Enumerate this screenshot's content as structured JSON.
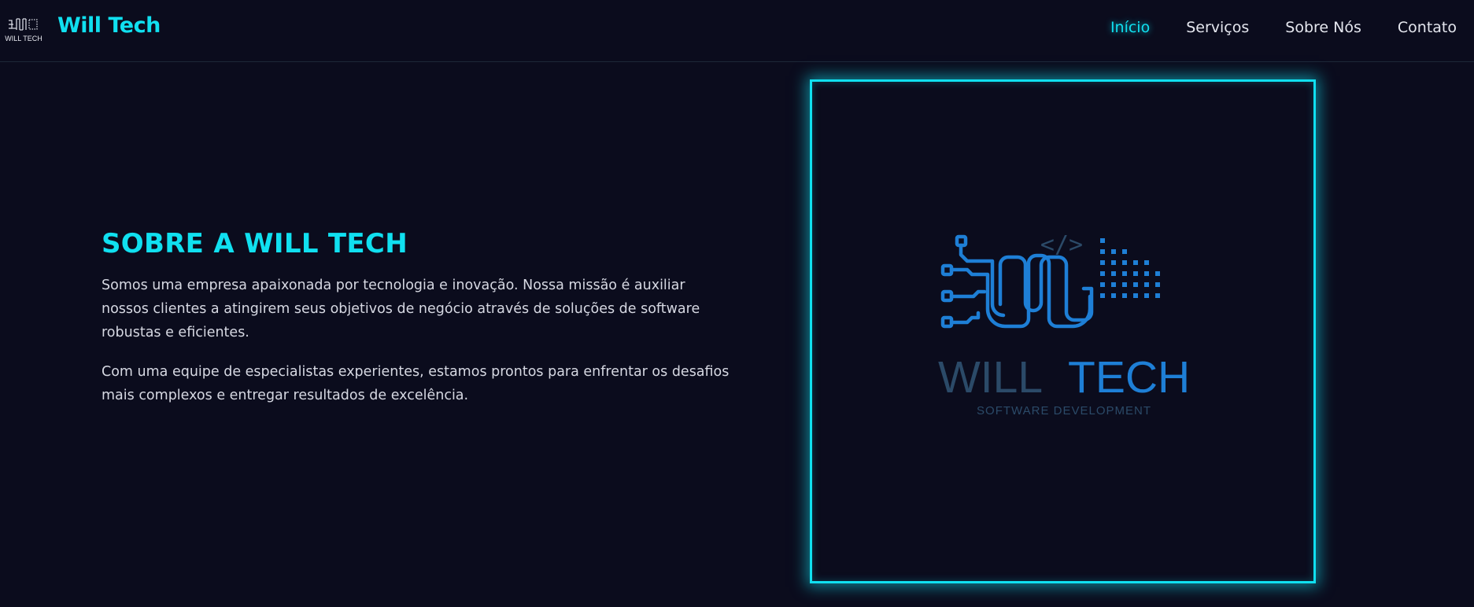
{
  "header": {
    "logo_text": "WILL TECH",
    "brand_name": "Will Tech",
    "nav": [
      {
        "label": "Início",
        "active": true
      },
      {
        "label": "Serviços",
        "active": false
      },
      {
        "label": "Sobre Nós",
        "active": false
      },
      {
        "label": "Contato",
        "active": false
      }
    ]
  },
  "about": {
    "title": "SOBRE A WILL TECH",
    "paragraphs": [
      "Somos uma empresa apaixonada por tecnologia e inovação. Nossa missão é auxiliar nossos clientes a atingirem seus objetivos de negócio através de soluções de software robustas e eficientes.",
      "Com uma equipe de especialistas experientes, estamos prontos para enfrentar os desafios mais complexos e entregar resultados de excelência."
    ]
  },
  "hero_image": {
    "code_tag": "</>",
    "word_will": "WILL",
    "word_tech": "TECH",
    "subtitle": "SOFTWARE DEVELOPMENT"
  },
  "colors": {
    "background": "#0b0c1d",
    "accent": "#10e0f0",
    "logo_blue": "#1e7fd6",
    "logo_dark": "#2b4a68"
  }
}
